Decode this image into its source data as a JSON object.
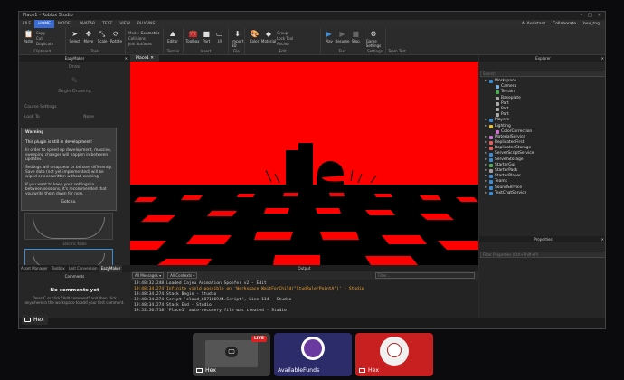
{
  "window": {
    "title": "Place1 - Roblox Studio"
  },
  "menu": {
    "items": [
      "FILE",
      "HOME",
      "MODEL",
      "AVATAR",
      "TEST",
      "VIEW",
      "PLUGINS"
    ],
    "active": "HOME",
    "ai_assistant": "AI Assistant",
    "collaborate": "Collaborate",
    "user": "hex_tng"
  },
  "ribbon": {
    "clipboard": {
      "name": "Clipboard",
      "items": [
        "Paste",
        "Copy",
        "Cut",
        "Duplicate"
      ]
    },
    "tools": {
      "name": "Tools",
      "items": [
        "Select",
        "Move",
        "Scale",
        "Rotate"
      ]
    },
    "mode": {
      "label": "Mode:",
      "value": "Geometric",
      "collisions": "Collisions",
      "join": "Join Surfaces"
    },
    "terrain": {
      "name": "Terrain",
      "editor": "Editor"
    },
    "insert": {
      "name": "Insert",
      "toolbox": "Toolbox",
      "part": "Part",
      "ui": "UI"
    },
    "file": {
      "name": "File",
      "import": "Import 3D"
    },
    "edit": {
      "name": "Edit",
      "color": "Color",
      "material": "Material",
      "group": "Group",
      "lock": "Lock Tool",
      "anchor": "Anchor"
    },
    "test": {
      "name": "Test",
      "play": "Play",
      "resume": "Resume",
      "stop": "Stop"
    },
    "settings": {
      "name": "Settings",
      "game_settings": "Game Settings"
    },
    "team_test": {
      "name": "Team Test"
    }
  },
  "left_panel": {
    "title": "EazyMaker",
    "draw": "Draw",
    "begin_drawing": "Begin Drawing",
    "course_settings": "Course Settings",
    "look_to": "Look To",
    "none": "None",
    "electric_label": "Electric Kabe",
    "warning": {
      "title": "Warning",
      "line1": "This plugin is still in development!",
      "line2": "In order to speed up development, massive, sweeping changes will happen in between updates.",
      "line3": "Settings will disappear or behave differently. Save data (not yet implemented) will be wiped or overwritten without warning.",
      "line4": "If you want to keep your settings in between sessions, it's recommended that you write them down for now.",
      "button": "Gotcha."
    }
  },
  "bottom_tabs": [
    "Asset Manager",
    "Toolbox",
    "Unit Conversion",
    "EazyMaker"
  ],
  "comments": {
    "title": "Comments",
    "heading": "No comments yet",
    "desc": "Press C or click \"Add comment\" and then click anywhere in the workspace to add your first comment."
  },
  "viewport": {
    "tab": "Place1"
  },
  "output": {
    "title": "Output",
    "filter1": "All Messages",
    "filter2": "All Contexts",
    "filter_placeholder": "Filter...",
    "lines": [
      {
        "time": "19:48:32.248",
        "text": "Loaded Cajeu Animation Spoofer v2  -  Edit",
        "kind": "info"
      },
      {
        "time": "19:48:34.274",
        "text": "Infinite yield possible on 'Workspace:WaitForChild(\"StudRulerPointA\")'  -  Studio",
        "kind": "warn"
      },
      {
        "time": "19:48:34.274",
        "text": "Stack Begin  -  Studio",
        "kind": "info"
      },
      {
        "time": "19:48:34.274",
        "text": "Script 'cloud_687166944.Script', Line 114  -  Studio",
        "kind": "info"
      },
      {
        "time": "19:48:34.274",
        "text": "Stack End  -  Studio",
        "kind": "info"
      },
      {
        "time": "19:52:56.718",
        "text": "'Place1' auto-recovery file was created  -  Studio",
        "kind": "info"
      }
    ]
  },
  "explorer": {
    "title": "Explorer",
    "search": "Search",
    "items": [
      {
        "name": "Workspace",
        "indent": 0,
        "color": "#3c8dd8"
      },
      {
        "name": "Camera",
        "indent": 1,
        "color": "#7ab0e0"
      },
      {
        "name": "Terrain",
        "indent": 1,
        "color": "#4caf50"
      },
      {
        "name": "Baseplate",
        "indent": 1,
        "color": "#aaaaaa"
      },
      {
        "name": "Part",
        "indent": 1,
        "color": "#aaaaaa"
      },
      {
        "name": "Part",
        "indent": 1,
        "color": "#aaaaaa"
      },
      {
        "name": "Part",
        "indent": 1,
        "color": "#aaaaaa"
      },
      {
        "name": "Players",
        "indent": 0,
        "color": "#3c8dd8"
      },
      {
        "name": "Lighting",
        "indent": 0,
        "color": "#e8c040"
      },
      {
        "name": "ColorCorrection",
        "indent": 1,
        "color": "#d070d0"
      },
      {
        "name": "MaterialService",
        "indent": 0,
        "color": "#d070d0"
      },
      {
        "name": "ReplicatedFirst",
        "indent": 0,
        "color": "#e06060"
      },
      {
        "name": "ReplicatedStorage",
        "indent": 0,
        "color": "#e06060"
      },
      {
        "name": "ServerScriptService",
        "indent": 0,
        "color": "#3c8dd8"
      },
      {
        "name": "ServerStorage",
        "indent": 0,
        "color": "#3c8dd8"
      },
      {
        "name": "StarterGui",
        "indent": 0,
        "color": "#4caf50"
      },
      {
        "name": "StarterPack",
        "indent": 0,
        "color": "#a0a0a0"
      },
      {
        "name": "StarterPlayer",
        "indent": 0,
        "color": "#3c8dd8"
      },
      {
        "name": "Teams",
        "indent": 0,
        "color": "#3c8dd8"
      },
      {
        "name": "SoundService",
        "indent": 0,
        "color": "#3c8dd8"
      },
      {
        "name": "TextChatService",
        "indent": 0,
        "color": "#3c8dd8"
      }
    ]
  },
  "properties": {
    "title": "Properties",
    "filter": "Filter Properties (Ctrl+Shift+P)"
  },
  "status": {
    "user": "Hex"
  },
  "taskbar": {
    "live": "LIVE",
    "items": [
      {
        "label": "Hex"
      },
      {
        "label": "AvailableFunds"
      },
      {
        "label": "Hex"
      }
    ]
  }
}
